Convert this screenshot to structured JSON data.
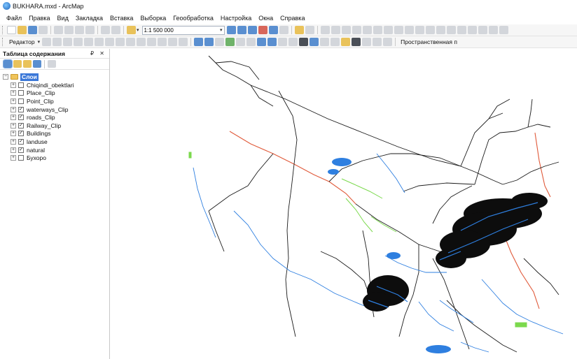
{
  "window": {
    "title": "BUKHARA.mxd - ArcMap"
  },
  "menu": {
    "items": [
      "Файл",
      "Правка",
      "Вид",
      "Закладка",
      "Вставка",
      "Выборка",
      "Геообработка",
      "Настройка",
      "Окна",
      "Справка"
    ]
  },
  "toolbar": {
    "scale_value": "1:1 500 000",
    "editor_label": "Редактор",
    "spatial_label": "Пространственная п"
  },
  "toc": {
    "title": "Таблица содержания",
    "controls": "₽ ✕",
    "root_layer": "Слои",
    "layers": [
      {
        "name": "Chiqindi_obektlari",
        "checked": false,
        "mark": ""
      },
      {
        "name": "Place_Clip",
        "checked": false,
        "mark": ""
      },
      {
        "name": "Point_Clip",
        "checked": false,
        "mark": ""
      },
      {
        "name": "waterways_Clip",
        "checked": true,
        "mark": "✓"
      },
      {
        "name": "roads_Clip",
        "checked": true,
        "mark": "✓"
      },
      {
        "name": "Railway_Clip",
        "checked": true,
        "mark": "✓"
      },
      {
        "name": "Buildings",
        "checked": true,
        "mark": "✓"
      },
      {
        "name": "landuse",
        "checked": true,
        "mark": "✓"
      },
      {
        "name": "natural",
        "checked": true,
        "mark": "✓"
      },
      {
        "name": "Бухоро",
        "checked": false,
        "mark": ""
      }
    ]
  },
  "map": {
    "colors": {
      "roads": "#1a1a1a",
      "waterways": "#2e7fe0",
      "railway": "#e05a3a",
      "landuse": "#7bd94d",
      "buildings": "#0d0d0d"
    }
  }
}
